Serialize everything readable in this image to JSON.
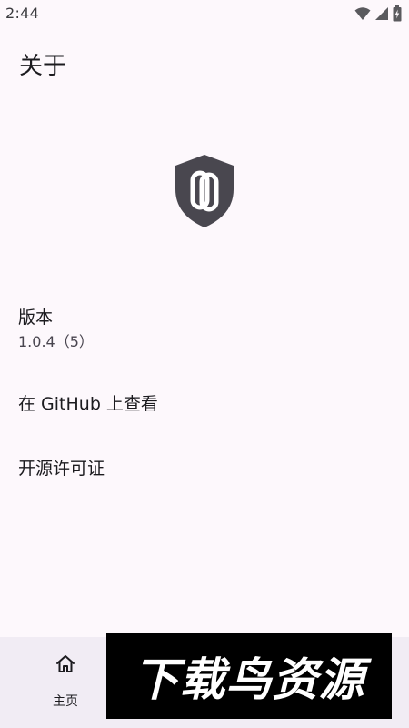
{
  "status_bar": {
    "time": "2:44",
    "icons": [
      "wifi-icon",
      "signal-icon",
      "battery-icon"
    ]
  },
  "header": {
    "title": "关于"
  },
  "logo": {
    "icon": "shield-link-icon",
    "color": "#49474f"
  },
  "preferences": [
    {
      "title": "版本",
      "summary": "1.0.4（5）"
    },
    {
      "title": "在 GitHub 上查看"
    },
    {
      "title": "开源许可证"
    }
  ],
  "bottom_nav": {
    "items": [
      {
        "label": "主页",
        "icon": "home-icon"
      }
    ]
  },
  "watermark": {
    "text": "下载鸟资源"
  },
  "colors": {
    "background": "#fdf8fc",
    "nav_background": "#f1ecf4",
    "text_primary": "#1c1b1f",
    "text_secondary": "#49454f"
  }
}
